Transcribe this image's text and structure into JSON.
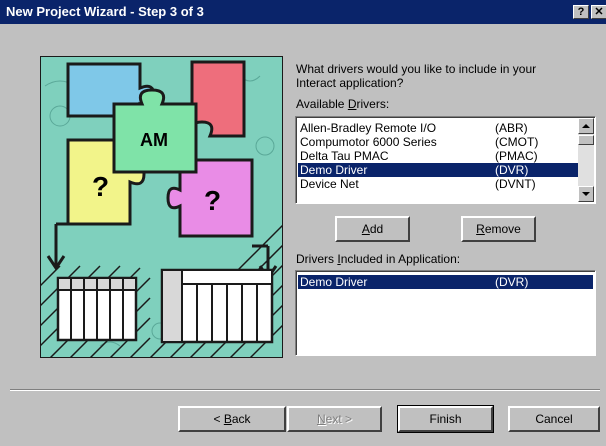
{
  "window": {
    "title": "New Project Wizard - Step 3 of 3",
    "help_glyph": "?",
    "close_glyph": "✕"
  },
  "illustration": {
    "center_piece_text": "AM",
    "left_piece_text": "?",
    "right_piece_text": "?"
  },
  "prompt": {
    "line1": "What drivers would you like to include in your",
    "line2": "Interact application?"
  },
  "available": {
    "label_before": "Available ",
    "label_hotkey": "D",
    "label_after": "rivers:",
    "items": [
      {
        "name": "Allen-Bradley Remote I/O",
        "code": "(ABR)",
        "selected": false
      },
      {
        "name": "Compumotor 6000 Series",
        "code": "(CMOT)",
        "selected": false
      },
      {
        "name": "Delta Tau PMAC",
        "code": "(PMAC)",
        "selected": false
      },
      {
        "name": "Demo Driver",
        "code": "(DVR)",
        "selected": true
      },
      {
        "name": "Device Net",
        "code": "(DVNT)",
        "selected": false
      }
    ]
  },
  "buttons": {
    "add_hotkey": "A",
    "add_rest": "dd",
    "remove_hotkey": "R",
    "remove_rest": "emove",
    "back_arrow": "< ",
    "back_hotkey": "B",
    "back_rest": "ack",
    "next_hotkey": "N",
    "next_rest": "ext >",
    "finish": "Finish",
    "cancel": "Cancel"
  },
  "included": {
    "label_before": "Drivers ",
    "label_hotkey": "I",
    "label_after": "ncluded in Application:",
    "items": [
      {
        "name": "Demo Driver",
        "code": "(DVR)",
        "selected": true
      }
    ]
  },
  "colors": {
    "face": "#c0c0c0",
    "title_bg": "#0a246a",
    "selection": "#0a246a",
    "art_bg": "#7fd0bd",
    "piece_blue": "#7fc8e8",
    "piece_red": "#ee6e7c",
    "piece_green": "#7fe3a8",
    "piece_yellow": "#f2f48a",
    "piece_magenta": "#e98ce6"
  }
}
